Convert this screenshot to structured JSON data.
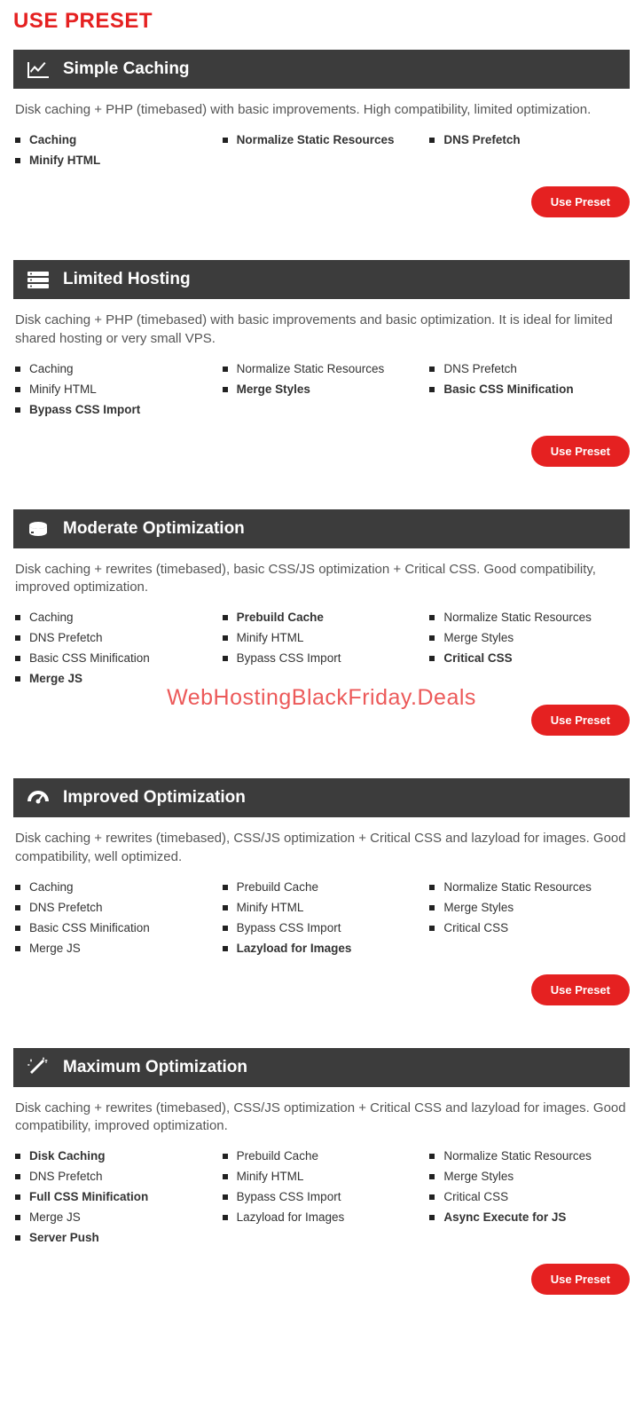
{
  "page_title": "USE PRESET",
  "use_button_label": "Use Preset",
  "watermark": "WebHostingBlackFriday.Deals",
  "presets": [
    {
      "title": "Simple Caching",
      "icon": "chart-line-icon",
      "desc": "Disk caching + PHP (timebased) with basic improvements. High compatibility, limited optimization.",
      "features": [
        {
          "label": "Caching",
          "bold": true
        },
        {
          "label": "Normalize Static Resources",
          "bold": true
        },
        {
          "label": "DNS Prefetch",
          "bold": true
        },
        {
          "label": "Minify HTML",
          "bold": true
        }
      ]
    },
    {
      "title": "Limited Hosting",
      "icon": "server-icon",
      "desc": "Disk caching + PHP (timebased) with basic improvements and basic optimization. It is ideal for limited shared hosting or very small VPS.",
      "features": [
        {
          "label": "Caching",
          "bold": false
        },
        {
          "label": "Normalize Static Resources",
          "bold": false
        },
        {
          "label": "DNS Prefetch",
          "bold": false
        },
        {
          "label": "Minify HTML",
          "bold": false
        },
        {
          "label": "Merge Styles",
          "bold": true
        },
        {
          "label": "Basic CSS Minification",
          "bold": true
        },
        {
          "label": "Bypass CSS Import",
          "bold": true
        }
      ]
    },
    {
      "title": "Moderate Optimization",
      "icon": "disk-icon",
      "desc": "Disk caching + rewrites (timebased), basic CSS/JS optimization + Critical CSS. Good compatibility, improved optimization.",
      "features": [
        {
          "label": "Caching",
          "bold": false
        },
        {
          "label": "Prebuild Cache",
          "bold": true
        },
        {
          "label": "Normalize Static Resources",
          "bold": false
        },
        {
          "label": "DNS Prefetch",
          "bold": false
        },
        {
          "label": "Minify HTML",
          "bold": false
        },
        {
          "label": "Merge Styles",
          "bold": false
        },
        {
          "label": "Basic CSS Minification",
          "bold": false
        },
        {
          "label": "Bypass CSS Import",
          "bold": false
        },
        {
          "label": "Critical CSS",
          "bold": true
        },
        {
          "label": "Merge JS",
          "bold": true
        }
      ]
    },
    {
      "title": "Improved Optimization",
      "icon": "gauge-icon",
      "desc": "Disk caching + rewrites (timebased), CSS/JS optimization + Critical CSS and lazyload for images. Good compatibility, well optimized.",
      "features": [
        {
          "label": "Caching",
          "bold": false
        },
        {
          "label": "Prebuild Cache",
          "bold": false
        },
        {
          "label": "Normalize Static Resources",
          "bold": false
        },
        {
          "label": "DNS Prefetch",
          "bold": false
        },
        {
          "label": "Minify HTML",
          "bold": false
        },
        {
          "label": "Merge Styles",
          "bold": false
        },
        {
          "label": "Basic CSS Minification",
          "bold": false
        },
        {
          "label": "Bypass CSS Import",
          "bold": false
        },
        {
          "label": "Critical CSS",
          "bold": false
        },
        {
          "label": "Merge JS",
          "bold": false
        },
        {
          "label": "Lazyload for Images",
          "bold": true
        }
      ]
    },
    {
      "title": "Maximum Optimization",
      "icon": "wand-icon",
      "desc": "Disk caching + rewrites (timebased), CSS/JS optimization + Critical CSS and lazyload for images. Good compatibility, improved optimization.",
      "features": [
        {
          "label": "Disk Caching",
          "bold": true
        },
        {
          "label": "Prebuild Cache",
          "bold": false
        },
        {
          "label": "Normalize Static Resources",
          "bold": false
        },
        {
          "label": "DNS Prefetch",
          "bold": false
        },
        {
          "label": "Minify HTML",
          "bold": false
        },
        {
          "label": "Merge Styles",
          "bold": false
        },
        {
          "label": "Full CSS Minification",
          "bold": true
        },
        {
          "label": "Bypass CSS Import",
          "bold": false
        },
        {
          "label": "Critical CSS",
          "bold": false
        },
        {
          "label": "Merge JS",
          "bold": false
        },
        {
          "label": "Lazyload for Images",
          "bold": false
        },
        {
          "label": "Async Execute for JS",
          "bold": true
        },
        {
          "label": "Server Push",
          "bold": true
        }
      ]
    }
  ]
}
